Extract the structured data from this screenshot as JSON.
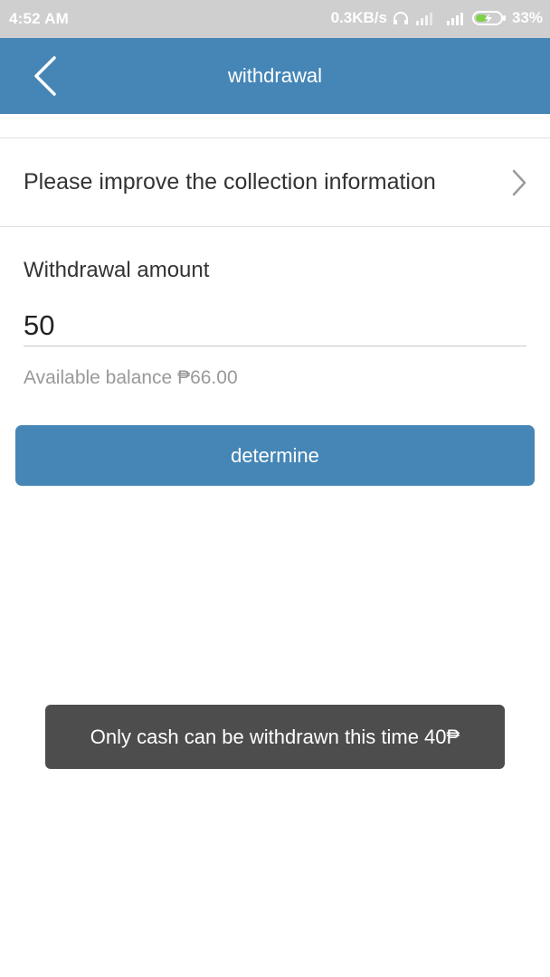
{
  "status_bar": {
    "time": "4:52 AM",
    "network_speed": "0.3KB/s",
    "battery": "33%",
    "icons": [
      "headphones-icon",
      "signal-icon",
      "signal-4g-icon",
      "battery-charging-icon"
    ]
  },
  "app_bar": {
    "title": "withdrawal",
    "back_icon": "chevron-left-icon"
  },
  "collection": {
    "label": "Please improve the collection information",
    "chevron_icon": "chevron-right-icon"
  },
  "form": {
    "amount_label": "Withdrawal amount",
    "amount_value": "50",
    "balance_text": "Available balance ₱66.00"
  },
  "button": {
    "label": "determine"
  },
  "toast": {
    "message": "Only cash can be withdrawn this time 40₱"
  },
  "colors": {
    "primary": "#4586b6",
    "status_bar": "#cfcfcf",
    "toast_bg": "#4d4d4d",
    "muted_text": "#999999"
  }
}
